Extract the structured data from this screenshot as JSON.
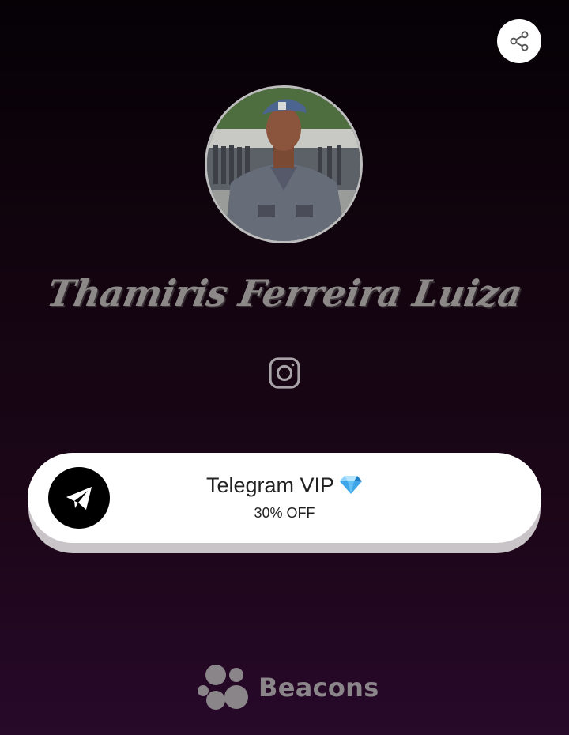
{
  "profile": {
    "name": "Thamiris Ferreira Luiza"
  },
  "icons": {
    "share": "share-icon",
    "instagram": "instagram-icon",
    "telegram": "telegram-icon",
    "diamond": "diamond-emoji",
    "brand": "beacons-logo-icon"
  },
  "link": {
    "title": "Telegram VIP",
    "subtitle": "30% OFF"
  },
  "footer": {
    "brand": "Beacons"
  },
  "colors": {
    "background_top": "#050105",
    "background_bottom": "#27092a",
    "card": "#ffffff",
    "text_muted": "#8c8888"
  }
}
